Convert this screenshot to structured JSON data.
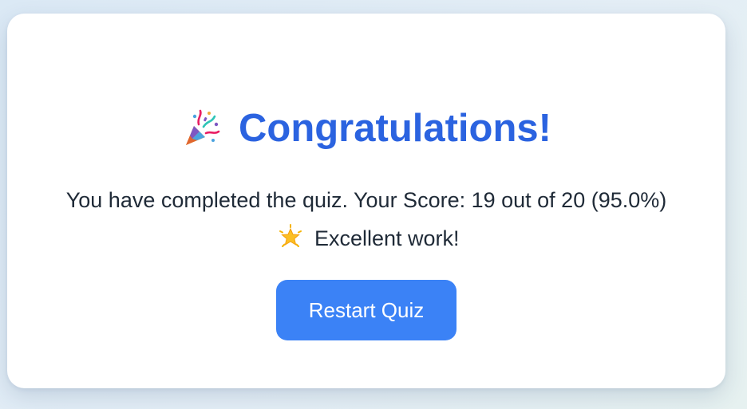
{
  "result": {
    "title": "Congratulations!",
    "title_icon": "party-popper-icon",
    "message_prefix": "You have completed the quiz. Your Score: 19 out of 20 (95.0%)",
    "message_icon": "glowing-star-icon",
    "message_suffix": "Excellent work!",
    "score": 19,
    "total": 20,
    "percent": "95.0%"
  },
  "actions": {
    "restart_label": "Restart Quiz"
  },
  "colors": {
    "title": "#2b63e0",
    "button": "#3b82f6",
    "text": "#1f2a37"
  }
}
